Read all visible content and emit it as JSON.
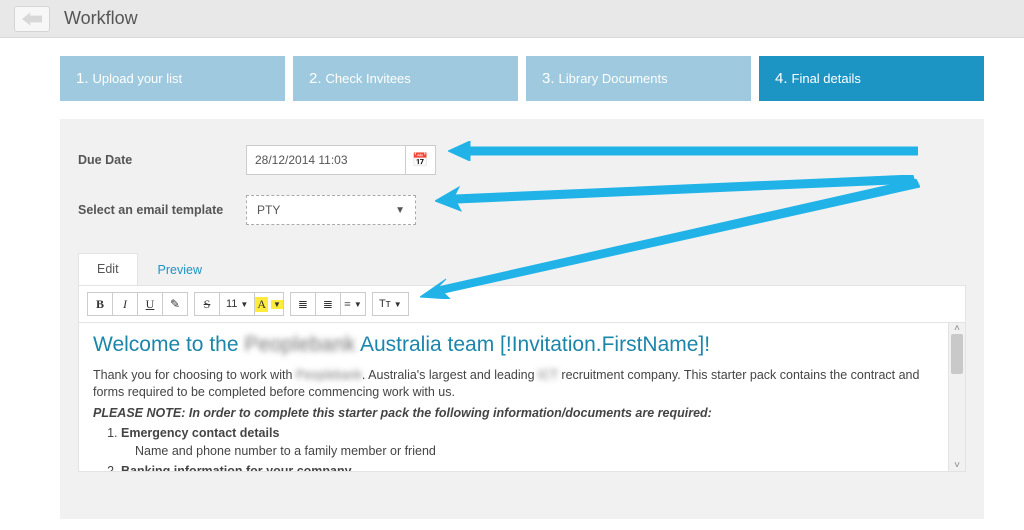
{
  "header": {
    "title": "Workflow"
  },
  "steps": [
    {
      "num": "1.",
      "label": "Upload your list"
    },
    {
      "num": "2.",
      "label": "Check Invitees"
    },
    {
      "num": "3.",
      "label": "Library Documents"
    },
    {
      "num": "4.",
      "label": "Final details"
    }
  ],
  "form": {
    "dueDate": {
      "label": "Due Date",
      "value": "28/12/2014 11:03"
    },
    "template": {
      "label": "Select an email template",
      "value": "PTY"
    }
  },
  "tabs": {
    "edit": "Edit",
    "preview": "Preview"
  },
  "toolbar": {
    "bold": "B",
    "italic": "I",
    "underline": "U",
    "eraser": "✎",
    "strike": "S",
    "size": "11",
    "highlight": "A",
    "ul": "≣",
    "ol": "≣",
    "align": "≡",
    "tt": "Tт"
  },
  "doc": {
    "heading_pre": "Welcome to the ",
    "heading_blur": "Peoplebank",
    "heading_post": " Australia team [!Invitation.FirstName]!",
    "p1a": "Thank you for choosing to work with ",
    "p1blur1": "Peoplebank",
    "p1b": ". Australia's largest and leading ",
    "p1blur2": "ICT",
    "p1c": " recruitment company. This starter pack contains the contract and forms required to be completed before commencing work with us.",
    "note": "PLEASE NOTE: In order to complete this starter pack the following information/documents are required:",
    "li1": "Emergency contact details",
    "li1sub": "Name and phone number to a family member or friend",
    "li2": "Banking information for your company"
  }
}
